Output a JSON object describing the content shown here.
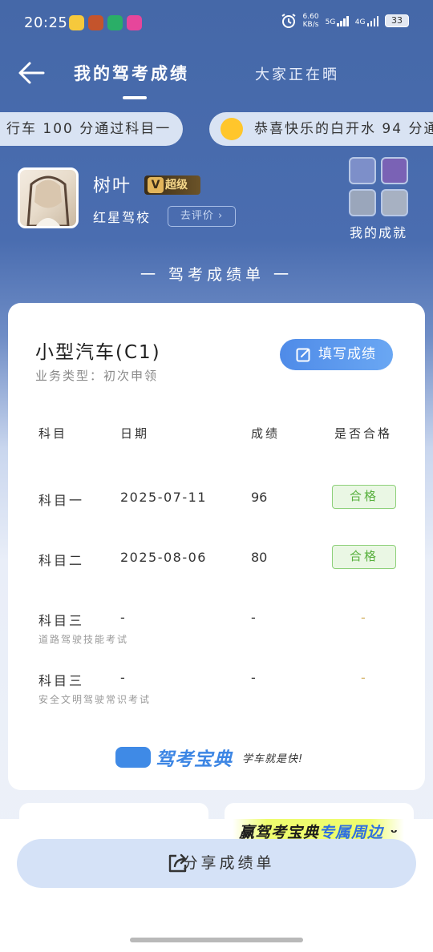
{
  "status_bar": {
    "time": "20:25",
    "net_speed_value": "6.60",
    "net_speed_unit": "KB/s",
    "sim1": "5G",
    "sim2": "4G",
    "battery": "33",
    "icons": [
      "alarm-icon",
      "signal-5g-icon",
      "signal-4g-icon",
      "battery-icon"
    ],
    "app_icon_colors": [
      "#f6c93c",
      "#c4542c",
      "#2aae67",
      "#e6469b"
    ]
  },
  "nav": {
    "active_tab": "我的驾考成绩",
    "other_tab": "大家正在晒"
  },
  "ticker": [
    "行车 100 分通过科目一",
    "恭喜快乐的白开水 94 分通"
  ],
  "profile": {
    "name": "树叶",
    "vip_badge": "超级",
    "vip_letter": "V",
    "school": "红星驾校",
    "review_label": "去评价",
    "achievements_label": "我的成就"
  },
  "section_title": "一 驾考成绩单 一",
  "card": {
    "vehicle_type": "小型汽车(C1)",
    "business_type": "业务类型：初次申领",
    "fill_button": "填写成绩",
    "headers": [
      "科目",
      "日期",
      "成绩",
      "是否合格"
    ],
    "rows": [
      {
        "subject": "科目一",
        "date": "2025-07-11",
        "score": "96",
        "result": "合格",
        "note": ""
      },
      {
        "subject": "科目二",
        "date": "2025-08-06",
        "score": "80",
        "result": "合格",
        "note": ""
      },
      {
        "subject": "科目三",
        "date": "-",
        "score": "-",
        "result": "-",
        "note": "道路驾驶技能考试"
      },
      {
        "subject": "科目三",
        "date": "-",
        "score": "-",
        "result": "-",
        "note": "安全文明驾驶常识考试"
      }
    ],
    "brand_name": "驾考宝典",
    "brand_slogan": "学车就是快!"
  },
  "promo": {
    "part1": "赢驾考宝典",
    "part2": "专属周边"
  },
  "share_button": "分享成绩单",
  "colors": {
    "header_blue": "#4568a8",
    "accent_blue": "#4f8be8",
    "pass_green": "#58b03e",
    "pending_gold": "#d6b46a"
  }
}
